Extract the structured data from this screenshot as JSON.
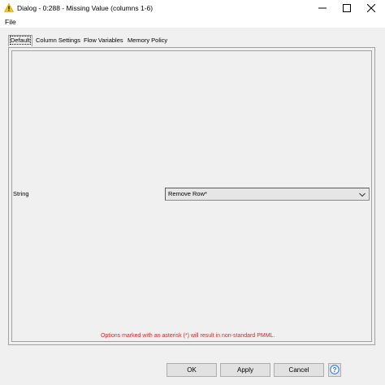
{
  "window": {
    "title": "Dialog - 0:288 - Missing Value (columns 1-6)",
    "icon": "warning-icon",
    "controls": [
      "minimize-icon",
      "maximize-icon",
      "close-icon"
    ]
  },
  "menu": {
    "file_label": "File"
  },
  "tabs": [
    {
      "label": "Default",
      "active": true
    },
    {
      "label": "Column Settings"
    },
    {
      "label": "Flow Variables"
    },
    {
      "label": "Memory Policy"
    }
  ],
  "settings": {
    "string_label": "String",
    "string_selected": "Remove Row*",
    "note": "Options marked with an asterisk (*) will result in non-standard PMML."
  },
  "buttons": {
    "ok": "OK",
    "apply": "Apply",
    "cancel": "Cancel",
    "help_icon": "help-icon"
  },
  "colors": {
    "warning": "#f5c518",
    "note": "#e02020",
    "help_icon": "#1e6fd0"
  }
}
